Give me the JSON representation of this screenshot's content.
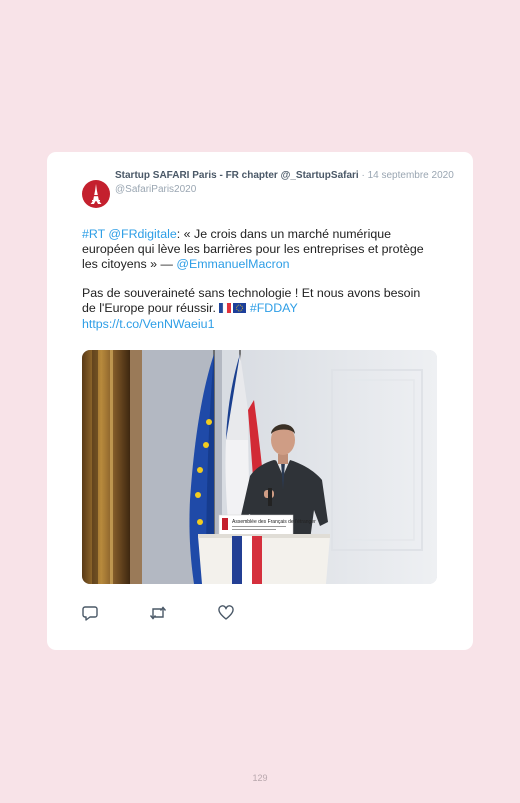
{
  "tweet": {
    "author_name": "Startup SAFARI Paris - FR chapter @_StartupSafari",
    "date": " · 14 septembre 2020",
    "handle": "@SafariParis2020",
    "p1_link1": "#RT",
    "p1_link2": "@FRdigitale",
    "p1_text": ": « Je crois dans un marché numérique européen qui lève les barrières pour les entreprises et protège les citoyens » — ",
    "p1_link3": "@EmmanuelMacron",
    "p2_text": "Pas de souveraineté sans technologie ! Et nous avons besoin de l'Europe pour réussir. ",
    "p2_hashtag": "#FDDAY",
    "p2_url": "https://t.co/VenNWaeiu1",
    "podium_sign": "Assemblée des Français de l'étranger"
  },
  "actions": {
    "reply_icon": "reply-icon",
    "retweet_icon": "retweet-icon",
    "like_icon": "heart-icon"
  },
  "page": {
    "number": "129"
  },
  "colors": {
    "background": "#f8e3e8",
    "card": "#ffffff",
    "link": "#2e9ee6",
    "avatar": "#c4202e"
  }
}
